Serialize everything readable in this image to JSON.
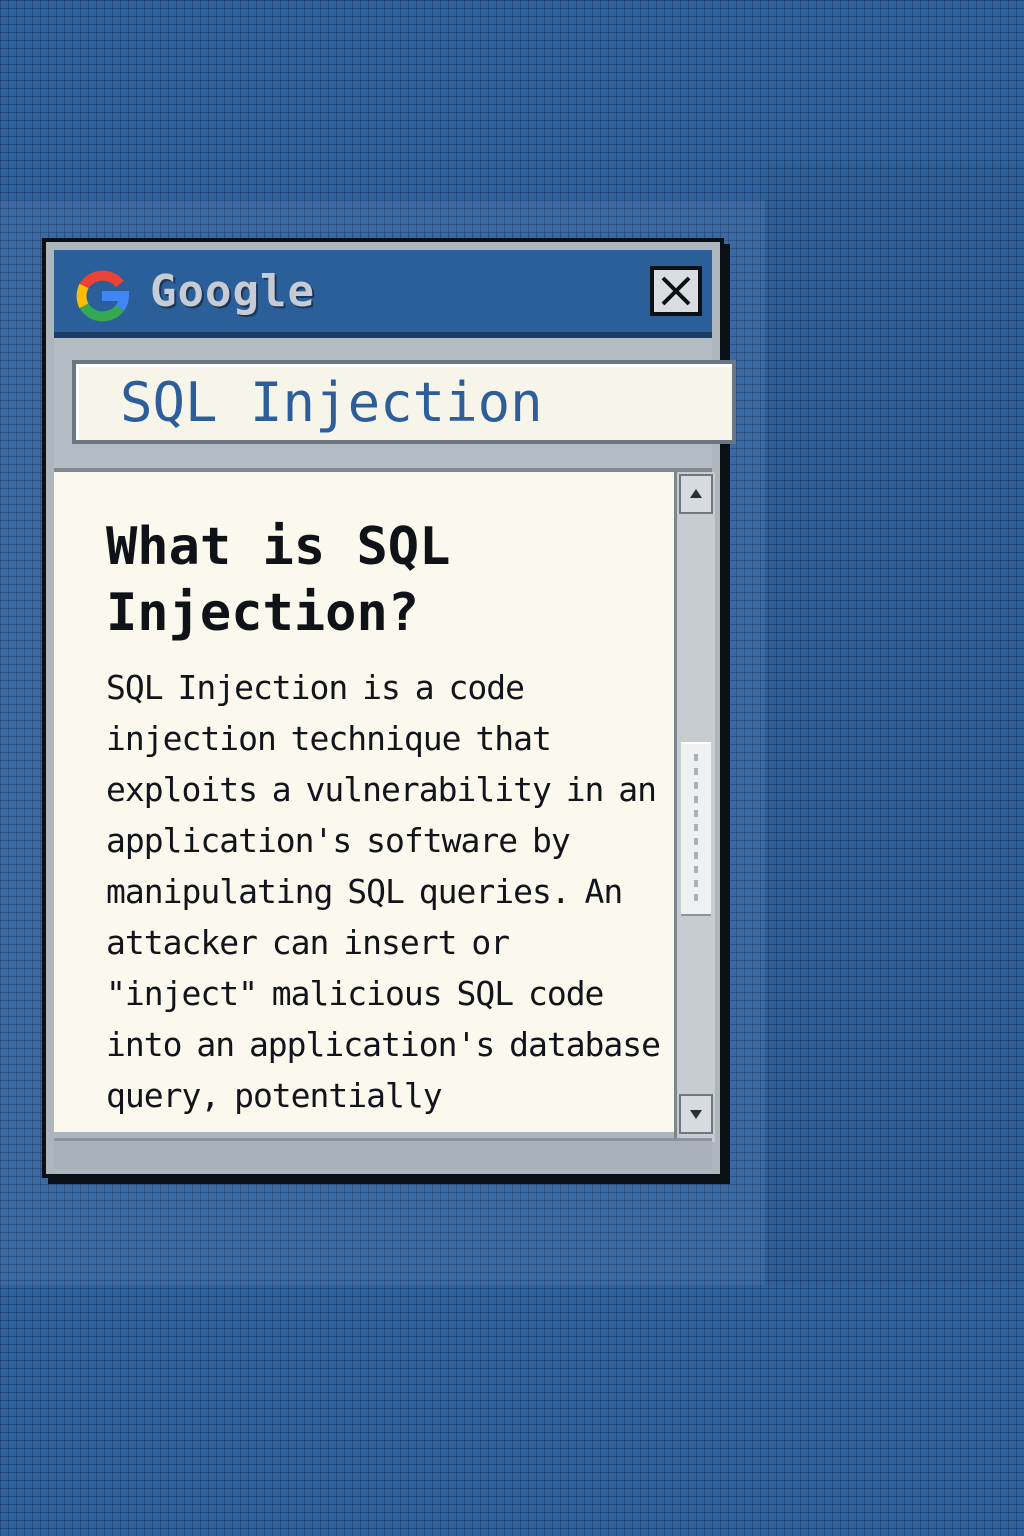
{
  "window": {
    "brand": "Google",
    "search": {
      "value": "SQL Injection"
    }
  },
  "article": {
    "title": "What is SQL Injection?",
    "body": "SQL Injection is a code injection technique that exploits a vulnerability in an application's software by manipulating SQL queries. An attacker can insert or \"inject\" malicious SQL code into an application's database query, potentially"
  },
  "colors": {
    "desktop": "#2f63a0",
    "titlebar": "#2b5f99",
    "search_text": "#2d5e9a",
    "content_bg": "#fbf9ee"
  },
  "icons": {
    "logo": "google-g-icon",
    "close": "close-icon",
    "scroll_up": "arrow-up-icon",
    "scroll_down": "arrow-down-icon"
  }
}
